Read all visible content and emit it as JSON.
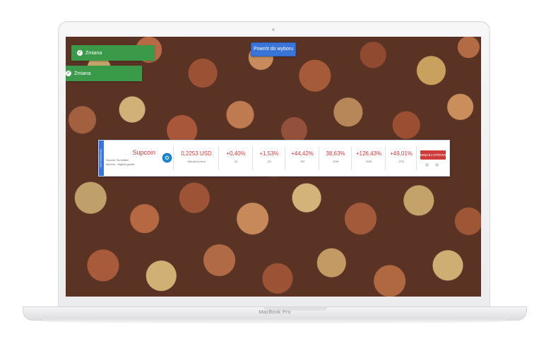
{
  "device": {
    "model": "MacBook Pro"
  },
  "notifications": [
    {
      "text": "Zmiana"
    },
    {
      "text": "Zmiana"
    }
  ],
  "back_button": {
    "label": "Powrót do wyboru"
  },
  "ticker": {
    "side_tab": "NOTOWANIA",
    "coin": {
      "name": "Supcoin",
      "detail_1": "Supcoin: Surrealism",
      "detail_2": "Altcoins – Highest growth"
    },
    "price": {
      "value": "0,2253 USD",
      "label": "Aktualna cena"
    },
    "changes": [
      {
        "value": "+0,40%",
        "label": "1D"
      },
      {
        "value": "+1,53%",
        "label": "1M"
      },
      {
        "value": "+44,42%",
        "label": "3M"
      },
      {
        "value": "38,63%",
        "label": "1DM"
      },
      {
        "value": "+126,43%",
        "label": "30M"
      },
      {
        "value": "+49,01%",
        "label": "YTD"
      }
    ],
    "more_button": "WIĘCEJ STRONY",
    "accent_color": "#d93838"
  }
}
